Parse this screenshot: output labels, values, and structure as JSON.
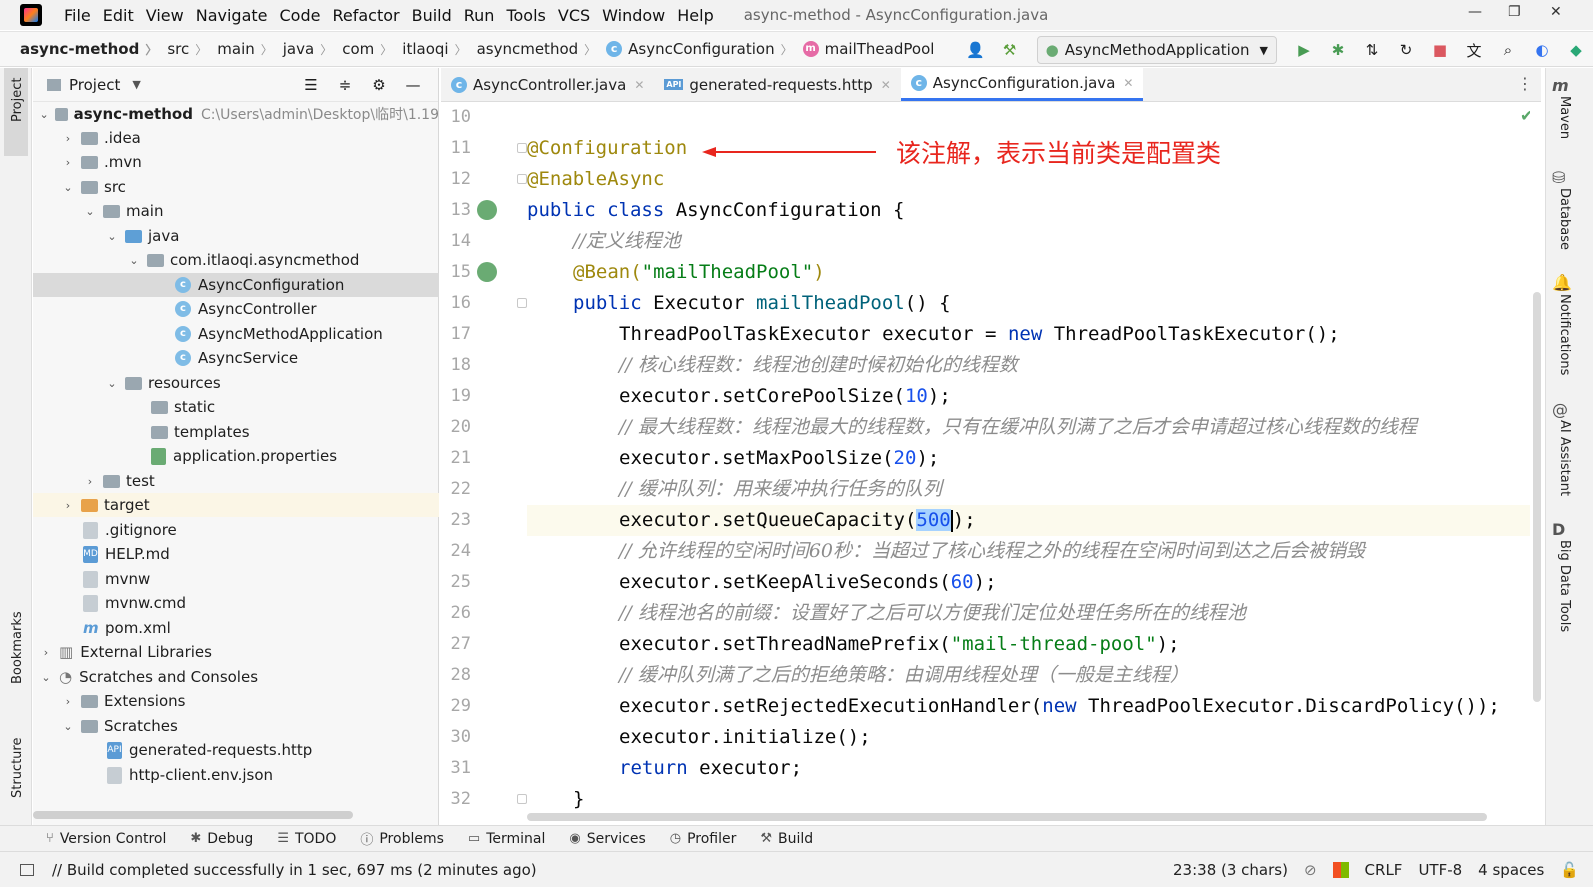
{
  "menu": {
    "items": [
      "File",
      "Edit",
      "View",
      "Navigate",
      "Code",
      "Refactor",
      "Build",
      "Run",
      "Tools",
      "VCS",
      "Window",
      "Help"
    ],
    "title": "async-method - AsyncConfiguration.java"
  },
  "breadcrumb": {
    "items": [
      "async-method",
      "src",
      "main",
      "java",
      "com",
      "itlaoqi",
      "asyncmethod",
      "AsyncConfiguration",
      "mailTheadPool"
    ]
  },
  "run_config": {
    "label": "AsyncMethodApplication"
  },
  "project_panel": {
    "title": "Project",
    "root_label": "async-method",
    "root_path": "C:\\Users\\admin\\Desktop\\临时\\1.19",
    "nodes": [
      "async-method",
      ".idea",
      ".mvn",
      "src",
      "main",
      "java",
      "com.itlaoqi.asyncmethod",
      "AsyncConfiguration",
      "AsyncController",
      "AsyncMethodApplication",
      "AsyncService",
      "resources",
      "static",
      "templates",
      "application.properties",
      "test",
      "target",
      ".gitignore",
      "HELP.md",
      "mvnw",
      "mvnw.cmd",
      "pom.xml",
      "External Libraries",
      "Scratches and Consoles",
      "Extensions",
      "Scratches",
      "generated-requests.http",
      "http-client.env.json"
    ]
  },
  "left_stripe": {
    "project": "Project",
    "bookmarks": "Bookmarks",
    "structure": "Structure"
  },
  "right_stripe": {
    "maven": "Maven",
    "database": "Database",
    "notifications": "Notifications",
    "ai_assistant": "AI Assistant",
    "big_data_tools": "Big Data Tools"
  },
  "tabs": [
    {
      "label": "AsyncController.java"
    },
    {
      "label": "generated-requests.http"
    },
    {
      "label": "AsyncConfiguration.java"
    }
  ],
  "editor": {
    "line_numbers": [
      "10",
      "11",
      "12",
      "13",
      "14",
      "15",
      "16",
      "17",
      "18",
      "19",
      "20",
      "21",
      "22",
      "23",
      "24",
      "25",
      "26",
      "27",
      "28",
      "29",
      "30",
      "31",
      "32"
    ],
    "annotation_text": "该注解，表示当前类是配置类",
    "code": {
      "l11": "@Configuration",
      "l12": "@EnableAsync",
      "l13_kw": "public class",
      "l13_rest": " AsyncConfiguration {",
      "l14": "//定义线程池",
      "l15_ann": "@Bean(",
      "l15_str": "\"mailTheadPool\"",
      "l15_end": ")",
      "l16_kw": "public",
      "l16_type": " Executor ",
      "l16_meth": "mailTheadPool",
      "l16_end": "() {",
      "l17_a": "ThreadPoolTaskExecutor executor = ",
      "l17_kw": "new",
      "l17_b": " ThreadPoolTaskExecutor();",
      "l18": "// 核心线程数：线程池创建时候初始化的线程数",
      "l19_a": "executor.setCorePoolSize(",
      "l19_n": "10",
      "l19_b": ");",
      "l20": "// 最大线程数：线程池最大的线程数，只有在缓冲队列满了之后才会申请超过核心线程数的线程",
      "l21_a": "executor.setMaxPoolSize(",
      "l21_n": "20",
      "l21_b": ");",
      "l22": "// 缓冲队列：用来缓冲执行任务的队列",
      "l23_a": "executor.setQueueCapacity(",
      "l23_n": "500",
      "l23_b": ");",
      "l24": "// 允许线程的空闲时间60秒：当超过了核心线程之外的线程在空闲时间到达之后会被销毁",
      "l25_a": "executor.setKeepAliveSeconds(",
      "l25_n": "60",
      "l25_b": ");",
      "l26": "// 线程池名的前缀：设置好了之后可以方便我们定位处理任务所在的线程池",
      "l27_a": "executor.setThreadNamePrefix(",
      "l27_s": "\"mail-thread-pool\"",
      "l27_b": ");",
      "l28": "// 缓冲队列满了之后的拒绝策略：由调用线程处理（一般是主线程）",
      "l29_a": "executor.setRejectedExecutionHandler(",
      "l29_kw": "new",
      "l29_b": " ThreadPoolExecutor.DiscardPolicy());",
      "l30": "executor.initialize();",
      "l31_kw": "return",
      "l31_b": " executor;",
      "l32": "}"
    }
  },
  "bottom_tools": [
    "Version Control",
    "Debug",
    "TODO",
    "Problems",
    "Terminal",
    "Services",
    "Profiler",
    "Build"
  ],
  "status": {
    "message": "// Build completed successfully in 1 sec, 697 ms (2 minutes ago)",
    "position": "23:38 (3 chars)",
    "line_sep": "CRLF",
    "encoding": "UTF-8",
    "indent": "4 spaces"
  },
  "colors": {
    "accent": "#3574f0",
    "annotation": "#e8261e",
    "keyword": "#0033b3",
    "string": "#067d17",
    "annotation_code": "#9e880d"
  }
}
